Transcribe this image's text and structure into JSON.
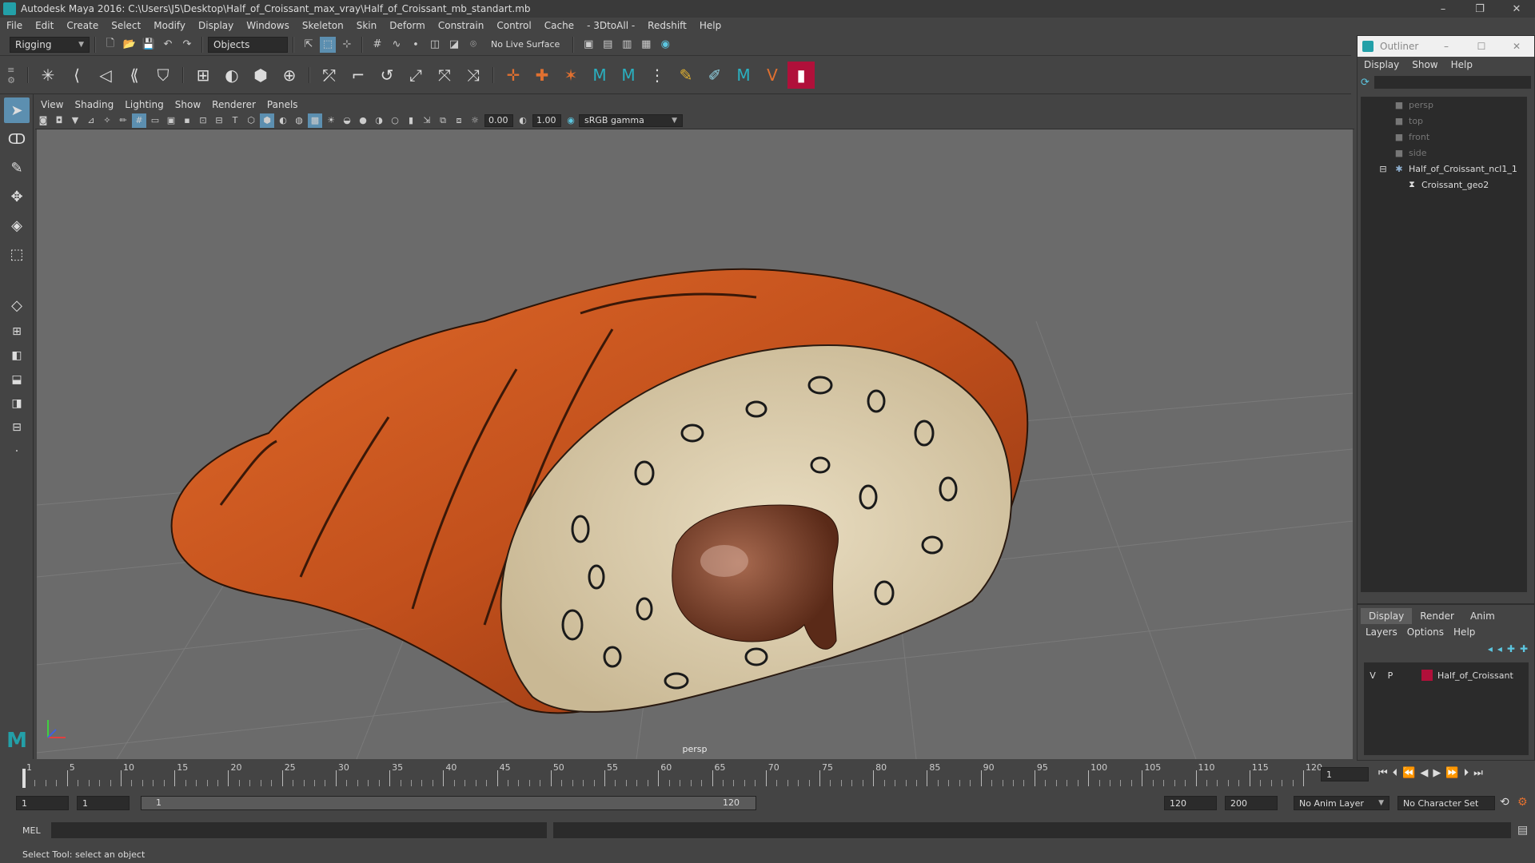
{
  "window": {
    "title": "Autodesk Maya 2016: C:\\Users\\J5\\Desktop\\Half_of_Croissant_max_vray\\Half_of_Croissant_mb_standart.mb",
    "minimize": "–",
    "maximize": "❐",
    "close": "✕"
  },
  "menubar": [
    "File",
    "Edit",
    "Create",
    "Select",
    "Modify",
    "Display",
    "Windows",
    "Skeleton",
    "Skin",
    "Deform",
    "Constrain",
    "Control",
    "Cache",
    "- 3DtoAll -",
    "Redshift",
    "Help"
  ],
  "statusline": {
    "mode": "Rigging",
    "selection_mode": "Objects",
    "live_surface": "No Live Surface"
  },
  "viewport": {
    "menu": [
      "View",
      "Shading",
      "Lighting",
      "Show",
      "Renderer",
      "Panels"
    ],
    "field_near": "0.00",
    "field_far": "1.00",
    "color_space": "sRGB gamma",
    "camera_label": "persp"
  },
  "outliner": {
    "title": "Outliner",
    "menu": [
      "Display",
      "Show",
      "Help"
    ],
    "items": [
      {
        "label": "persp",
        "type": "camera"
      },
      {
        "label": "top",
        "type": "camera"
      },
      {
        "label": "front",
        "type": "camera"
      },
      {
        "label": "side",
        "type": "camera"
      },
      {
        "label": "Half_of_Croissant_ncl1_1",
        "type": "group"
      },
      {
        "label": "Croissant_geo2",
        "type": "mesh"
      }
    ]
  },
  "layer_editor": {
    "tabs": [
      "Display",
      "Render",
      "Anim"
    ],
    "active_tab": "Display",
    "menu": [
      "Layers",
      "Options",
      "Help"
    ],
    "layer": {
      "v": "V",
      "p": "P",
      "name": "Half_of_Croissant",
      "color": "#b0103a"
    }
  },
  "timeline": {
    "labels": [
      "1",
      "5",
      "10",
      "15",
      "20",
      "25",
      "30",
      "35",
      "40",
      "45",
      "50",
      "55",
      "60",
      "65",
      "70",
      "75",
      "80",
      "85",
      "90",
      "95",
      "100",
      "105",
      "110",
      "115",
      "120"
    ],
    "current_frame": "1"
  },
  "range": {
    "start": "1",
    "inner_start": "1",
    "range_start_label": "1",
    "range_end_label": "120",
    "end": "120",
    "total_end": "200",
    "anim_layer": "No Anim Layer",
    "character_set": "No Character Set"
  },
  "command": {
    "lang": "MEL",
    "help": "Select Tool: select an object"
  }
}
